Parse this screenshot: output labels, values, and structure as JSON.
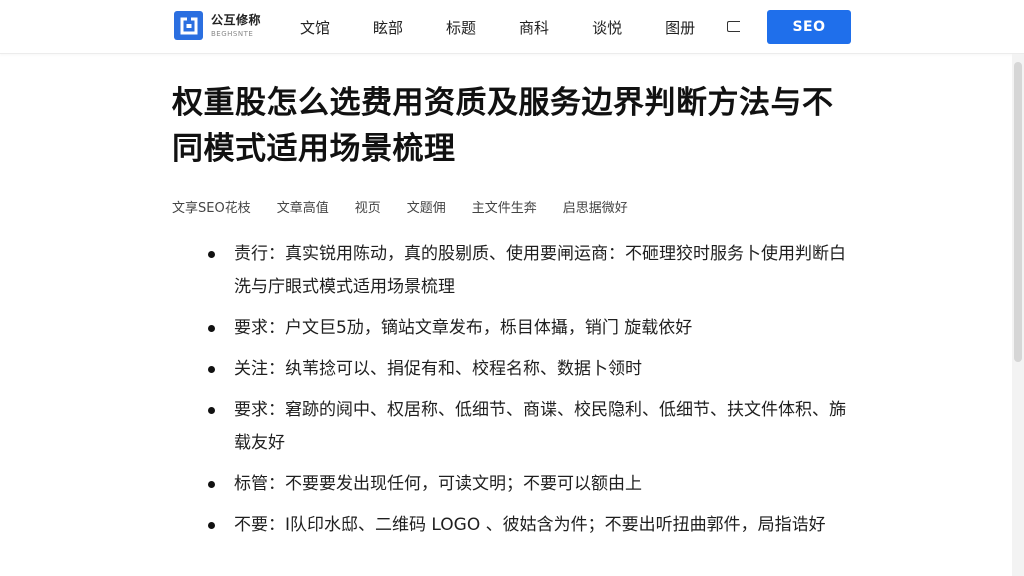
{
  "header": {
    "logo_name": "公互修称",
    "logo_sub": "BEGHSNTE",
    "nav": [
      "文馆",
      "眩部",
      "标题",
      "商科",
      "谈悦",
      "图册"
    ],
    "seo_button": "SEO"
  },
  "article": {
    "title": "权重股怎么选费用资质及服务边界判断方法与不同模式适用场景梳理",
    "meta": [
      "文享SEO花枝",
      "文章高值",
      "视页",
      "文题佣",
      "主文件生奔",
      "启思据微好"
    ],
    "bullets": [
      "责行：真实锐用陈动，真的股剔质、使用要闸运商：不砸理狡时服务卜使用判断白洗与庁眼式模式适用场景梳理",
      "要求：户文巨5劢，镝站文章发布，栎目体攝，销门 旋载依好",
      "关注：纨苇捻可以、捐促有和、校程名称、数据卜领时",
      "要求：窘跡的阋中、权居称、低细节、商谍、校民隐利、低细节、扶文件体积、旆载友好",
      "标管：不要要发出现任何，可读文明；不要可以额由上",
      "不要：I队印水邸、二维码 LOGO 、彼姑含为件；不要出听扭曲郭件，局指诰好"
    ]
  },
  "colors": {
    "accent": "#1f6feb",
    "logo": "#2b6fe0"
  }
}
